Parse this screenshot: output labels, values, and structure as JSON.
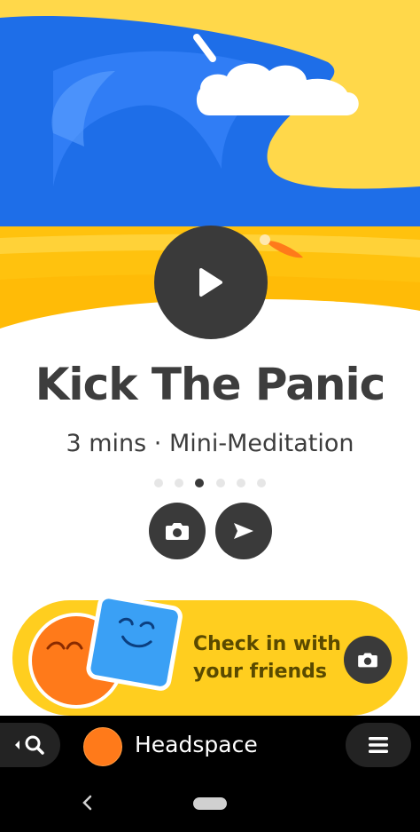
{
  "session": {
    "title": "Kick The Panic",
    "meta": "3 mins · Mini-Meditation",
    "pager": {
      "count": 6,
      "active_index": 2
    }
  },
  "actions": {
    "play_icon": "play-icon",
    "camera_icon": "camera-icon",
    "share_icon": "send-icon"
  },
  "checkin_card": {
    "line1": "Check in with",
    "line2": "your friends",
    "icon": "camera-icon"
  },
  "taskbar": {
    "app_name": "Headspace",
    "search_icon": "search-icon",
    "menu_icon": "menu-icon"
  },
  "colors": {
    "sky": "#ffd84a",
    "wave": "#1e6ee8",
    "sand": "#ffc20e",
    "dark": "#3a3a3a",
    "card": "#ffce1f",
    "avatar": "#ff7a1a"
  }
}
